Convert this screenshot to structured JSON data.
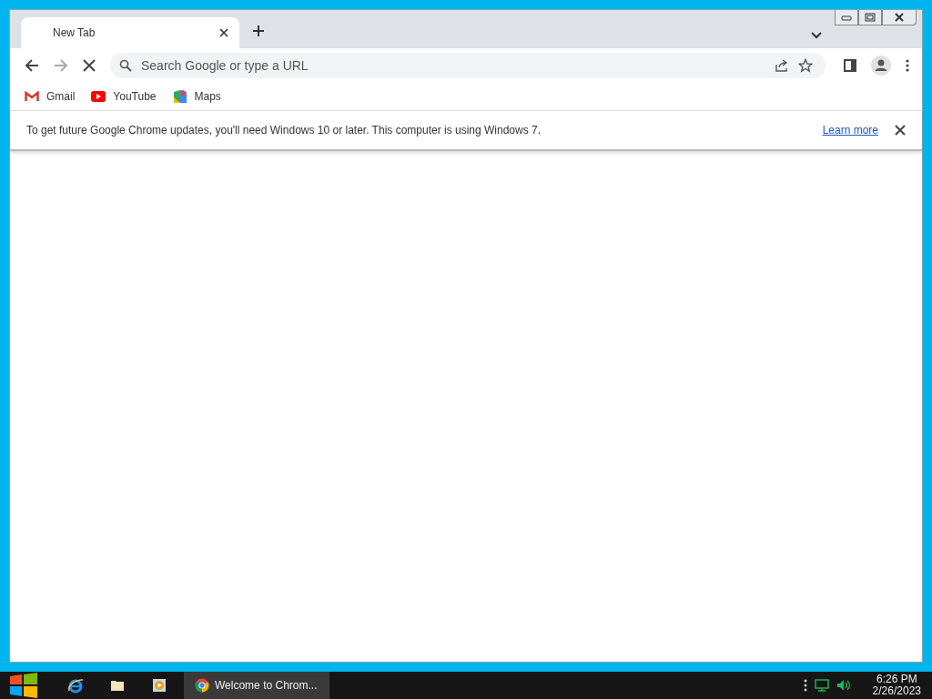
{
  "browser": {
    "tabs": [
      {
        "title": "New Tab",
        "selected": true
      }
    ],
    "loading": true,
    "address_bar": {
      "placeholder": "Search Google or type a URL"
    },
    "bookmarks": [
      {
        "label": "Gmail",
        "kind": "gmail"
      },
      {
        "label": "YouTube",
        "kind": "youtube"
      },
      {
        "label": "Maps",
        "kind": "maps"
      }
    ],
    "infobar": {
      "message": "To get future Google Chrome updates, you'll need Windows 10 or later. This computer is using Windows 7.",
      "link": "Learn more"
    }
  },
  "taskbar": {
    "items": [
      {
        "kind": "ie",
        "selected": false
      },
      {
        "kind": "folder",
        "selected": false
      },
      {
        "kind": "media",
        "selected": false
      },
      {
        "kind": "chrome",
        "label": "Welcome to Chrom...",
        "selected": true
      }
    ],
    "clock": {
      "time": "6:26 PM",
      "date": "2/26/2023"
    }
  }
}
